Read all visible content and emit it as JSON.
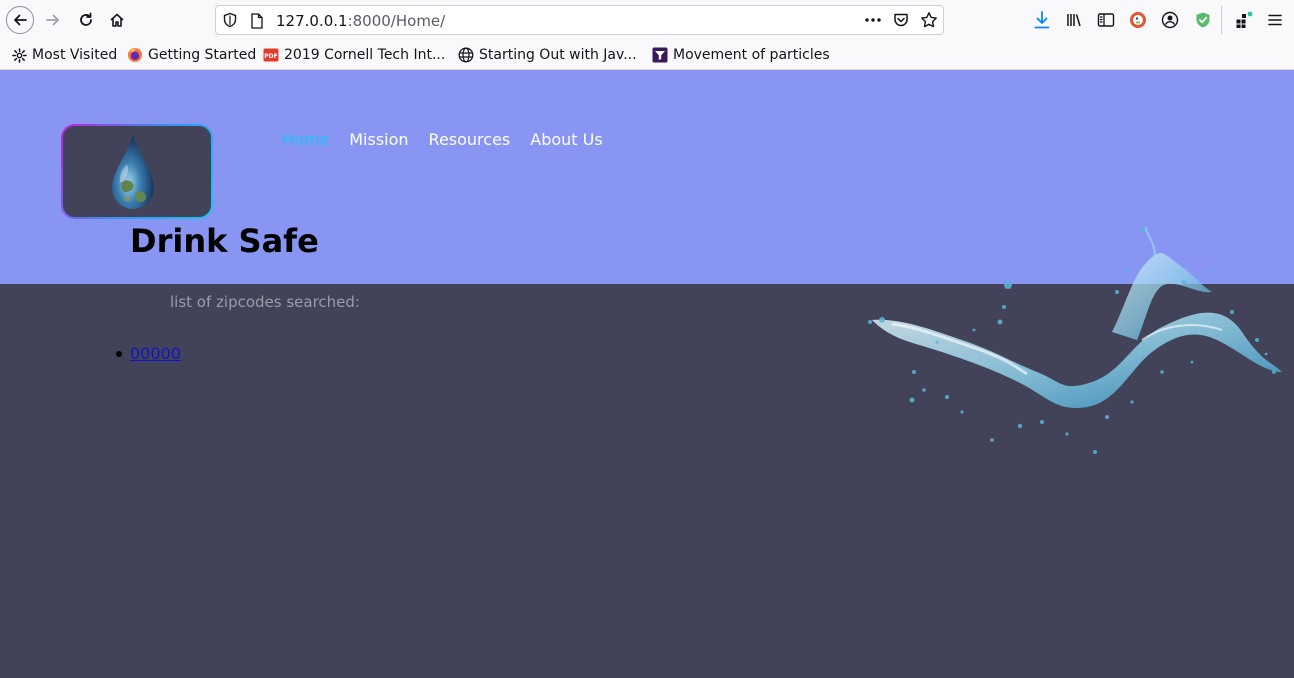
{
  "browser": {
    "url_host": "127.0.0.1",
    "url_rest": ":8000/Home/",
    "bookmarks": [
      {
        "label": "Most Visited",
        "icon": "gear-icon"
      },
      {
        "label": "Getting Started",
        "icon": "firefox-icon"
      },
      {
        "label": "2019 Cornell Tech Int...",
        "icon": "pdf-icon"
      },
      {
        "label": "Starting Out with Jav...",
        "icon": "globe-icon"
      },
      {
        "label": "Movement of particles",
        "icon": "filter-icon"
      }
    ],
    "pdf_badge": "PDF"
  },
  "site": {
    "title": "Drink Safe",
    "nav": [
      {
        "label": "Home",
        "active": true
      },
      {
        "label": "Mission",
        "active": false
      },
      {
        "label": "Resources",
        "active": false
      },
      {
        "label": "About Us",
        "active": false
      }
    ],
    "subtitle": "list of zipcodes searched:",
    "zipcodes": [
      "00000"
    ]
  },
  "colors": {
    "header_band": "#8895f3",
    "page_background": "#424358",
    "nav_active": "#1ac4f8",
    "nav_text": "#ffffff",
    "link": "#1313c8"
  }
}
